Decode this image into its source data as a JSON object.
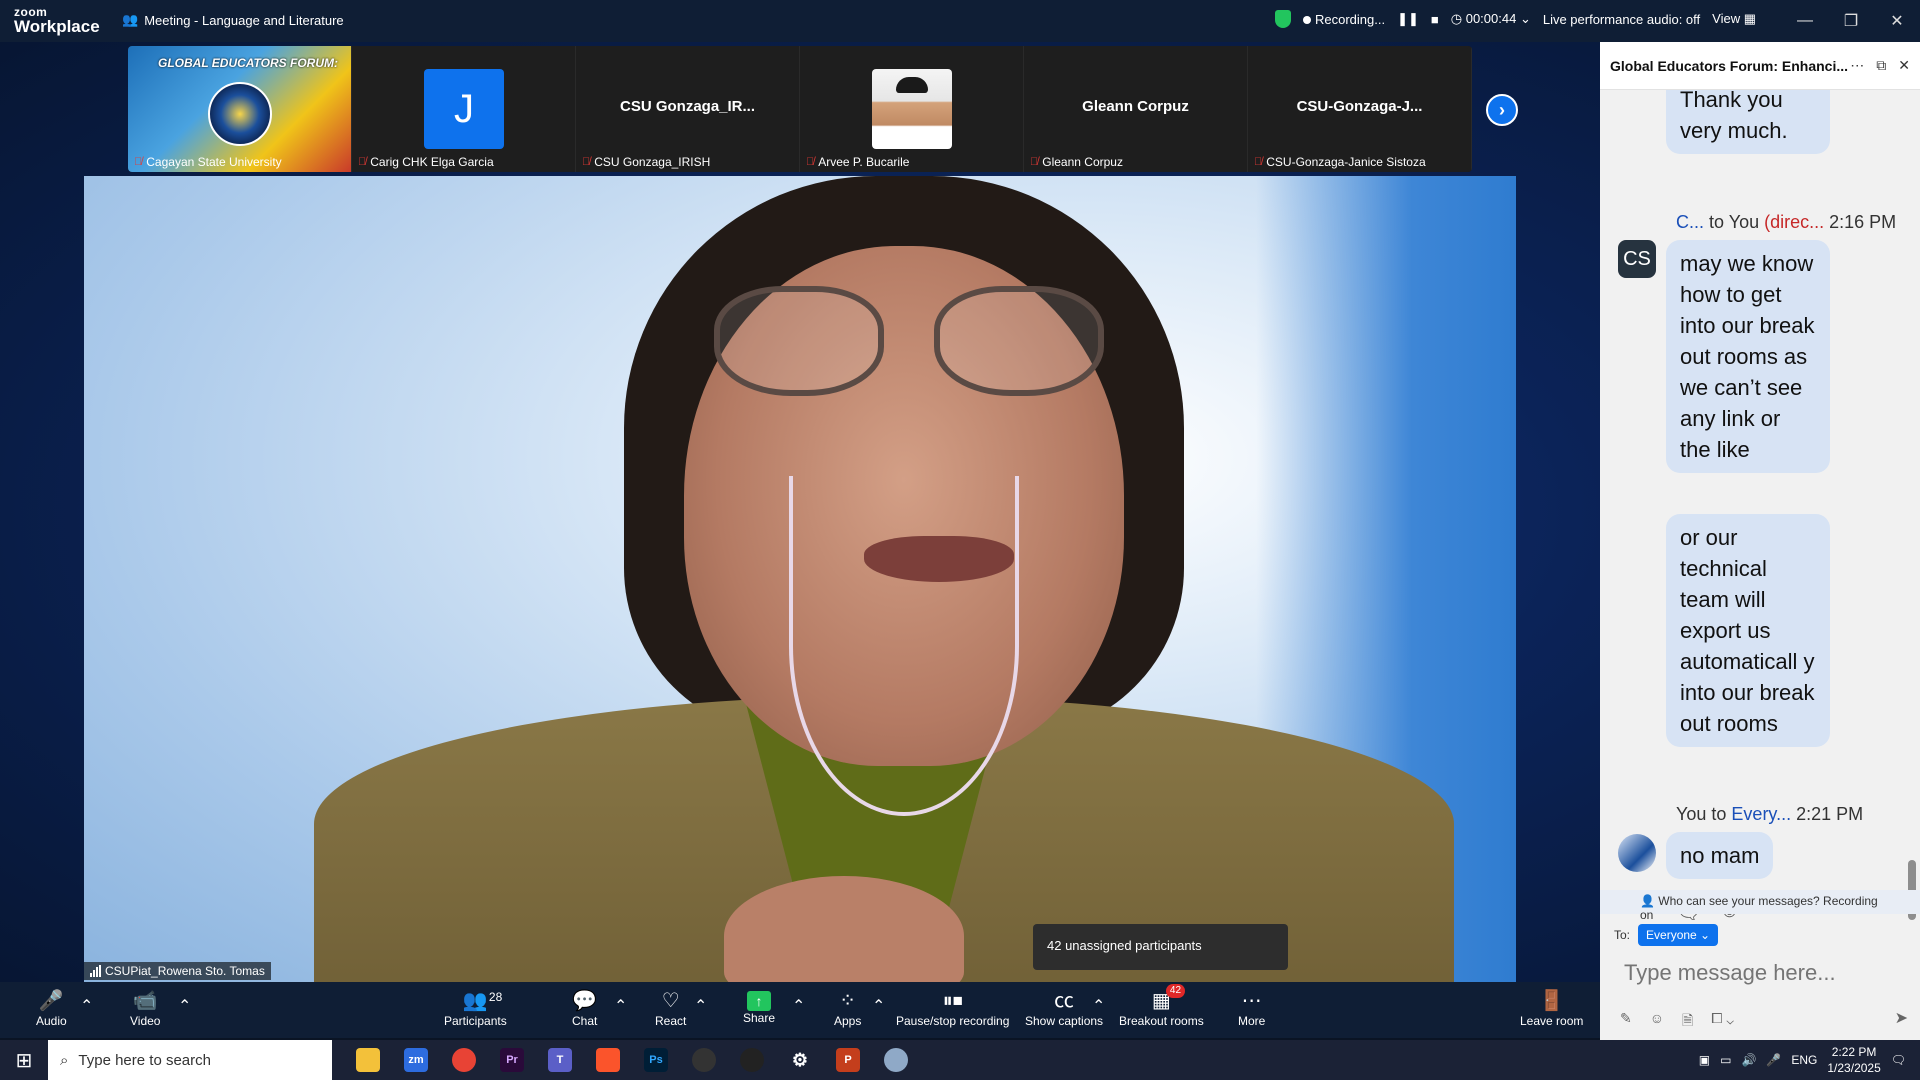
{
  "topbar": {
    "logo_line1": "zoom",
    "logo_line2": "Workplace",
    "meeting_title": "Meeting - Language and Literature",
    "recording_label": "Recording...",
    "timer": "00:00:44",
    "live_audio": "Live performance audio: off",
    "view_label": "View"
  },
  "strip": {
    "tiles": [
      {
        "name": "Cagayan State University",
        "banner": "GLOBAL EDUCATORS FORUM:"
      },
      {
        "name": "Carig CHK Elga Garcia",
        "initial": "J"
      },
      {
        "name": "CSU Gonzaga_IRISH",
        "center": "CSU  Gonzaga_IR..."
      },
      {
        "name": "Arvee P. Bucarile"
      },
      {
        "name": "Gleann Corpuz",
        "center": "Gleann Corpuz"
      },
      {
        "name": "CSU-Gonzaga-Janice Sistoza",
        "center": "CSU-Gonzaga-J..."
      }
    ]
  },
  "main_video": {
    "label": "CSUPiat_Rowena Sto. Tomas"
  },
  "tooltip": "42 unassigned participants",
  "toolbar": {
    "audio": "Audio",
    "video": "Video",
    "participants": "Participants",
    "participants_count": "28",
    "chat": "Chat",
    "react": "React",
    "share": "Share",
    "apps": "Apps",
    "pause_stop": "Pause/stop recording",
    "captions": "Show captions",
    "breakout": "Breakout rooms",
    "breakout_badge": "42",
    "more": "More",
    "leave": "Leave room"
  },
  "chat_panel": {
    "title": "Global Educators Forum: Enhanci...",
    "messages": [
      {
        "text": "Thank you very much."
      },
      {
        "sender": "C...",
        "to": "to You",
        "dm": "(direc...",
        "time": "2:16 PM",
        "avatar": "CS",
        "text": "may we know how to get into our break out rooms as we can’t see any link or the like"
      },
      {
        "text": "or our technical team will export us automaticall y into our break out rooms"
      },
      {
        "sender": "You",
        "to": "to",
        "recipient": "Every...",
        "time": "2:21 PM",
        "text": "no mam"
      }
    ],
    "who_can_see": "Who can see your messages? Recording on",
    "to_label": "To:",
    "to_value": "Everyone",
    "input_placeholder": "Type message here..."
  },
  "taskbar": {
    "search_placeholder": "Type here to search",
    "lang": "ENG",
    "time": "2:22 PM",
    "date": "1/23/2025"
  }
}
